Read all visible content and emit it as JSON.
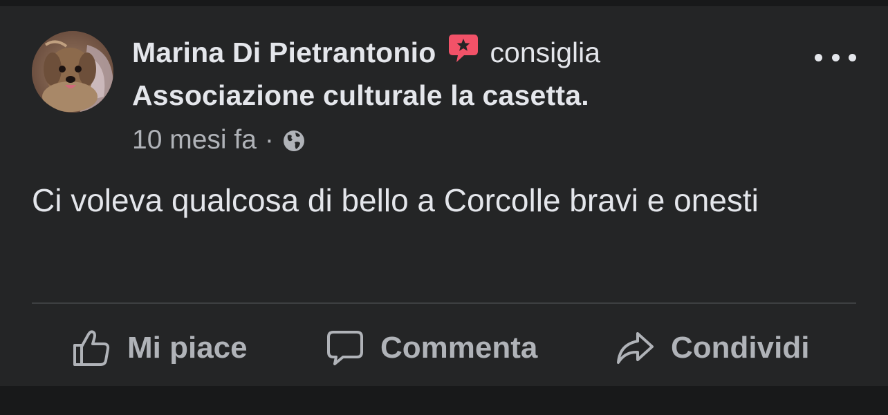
{
  "post": {
    "author": "Marina Di Pietrantonio",
    "verb": "consiglia",
    "page": "Associazione culturale la casetta.",
    "time": "10 mesi fa",
    "separator": "·",
    "privacy_icon": "globe-icon",
    "recommend_icon": "recommend-speech-bubble-star-icon",
    "text": "Ci voleva qualcosa di bello a Corcolle bravi e onesti"
  },
  "actions": {
    "like": {
      "label": "Mi piace",
      "icon": "thumbs-up-icon"
    },
    "comment": {
      "label": "Commenta",
      "icon": "comment-bubble-icon"
    },
    "share": {
      "label": "Condividi",
      "icon": "share-arrow-icon"
    }
  },
  "colors": {
    "card_bg": "#242526",
    "page_bg": "#18191a",
    "primary_text": "#e4e6eb",
    "secondary_text": "#b0b3b8",
    "recommend_red": "#f25268"
  }
}
